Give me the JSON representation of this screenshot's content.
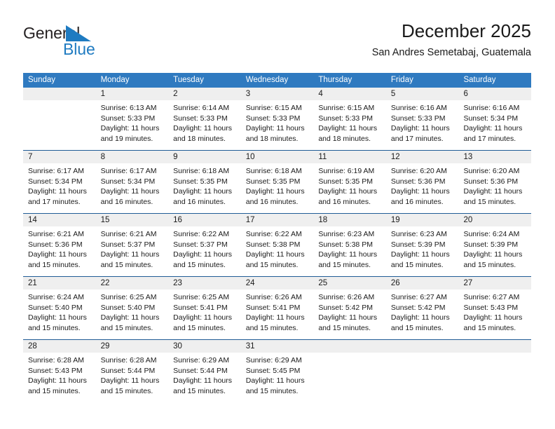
{
  "brand": {
    "word_one": "General",
    "word_two": "Blue",
    "triangle_icon": "triangle-icon",
    "color_blue": "#1f7bc1",
    "color_dark": "#231f20"
  },
  "header": {
    "title": "December 2025",
    "subtitle": "San Andres Semetabaj, Guatemala"
  },
  "theme": {
    "header_bg": "#2f7ac0",
    "header_text": "#ffffff",
    "week_separator": "#205c96",
    "date_band_bg": "#efefef",
    "body_bg": "#ffffff",
    "text": "#1a1a1a"
  },
  "calendar": {
    "weekdays": [
      "Sunday",
      "Monday",
      "Tuesday",
      "Wednesday",
      "Thursday",
      "Friday",
      "Saturday"
    ],
    "weeks": [
      [
        {
          "day": "",
          "lines": []
        },
        {
          "day": "1",
          "lines": [
            "Sunrise: 6:13 AM",
            "Sunset: 5:33 PM",
            "Daylight: 11 hours",
            "and 19 minutes."
          ]
        },
        {
          "day": "2",
          "lines": [
            "Sunrise: 6:14 AM",
            "Sunset: 5:33 PM",
            "Daylight: 11 hours",
            "and 18 minutes."
          ]
        },
        {
          "day": "3",
          "lines": [
            "Sunrise: 6:15 AM",
            "Sunset: 5:33 PM",
            "Daylight: 11 hours",
            "and 18 minutes."
          ]
        },
        {
          "day": "4",
          "lines": [
            "Sunrise: 6:15 AM",
            "Sunset: 5:33 PM",
            "Daylight: 11 hours",
            "and 18 minutes."
          ]
        },
        {
          "day": "5",
          "lines": [
            "Sunrise: 6:16 AM",
            "Sunset: 5:33 PM",
            "Daylight: 11 hours",
            "and 17 minutes."
          ]
        },
        {
          "day": "6",
          "lines": [
            "Sunrise: 6:16 AM",
            "Sunset: 5:34 PM",
            "Daylight: 11 hours",
            "and 17 minutes."
          ]
        }
      ],
      [
        {
          "day": "7",
          "lines": [
            "Sunrise: 6:17 AM",
            "Sunset: 5:34 PM",
            "Daylight: 11 hours",
            "and 17 minutes."
          ]
        },
        {
          "day": "8",
          "lines": [
            "Sunrise: 6:17 AM",
            "Sunset: 5:34 PM",
            "Daylight: 11 hours",
            "and 16 minutes."
          ]
        },
        {
          "day": "9",
          "lines": [
            "Sunrise: 6:18 AM",
            "Sunset: 5:35 PM",
            "Daylight: 11 hours",
            "and 16 minutes."
          ]
        },
        {
          "day": "10",
          "lines": [
            "Sunrise: 6:18 AM",
            "Sunset: 5:35 PM",
            "Daylight: 11 hours",
            "and 16 minutes."
          ]
        },
        {
          "day": "11",
          "lines": [
            "Sunrise: 6:19 AM",
            "Sunset: 5:35 PM",
            "Daylight: 11 hours",
            "and 16 minutes."
          ]
        },
        {
          "day": "12",
          "lines": [
            "Sunrise: 6:20 AM",
            "Sunset: 5:36 PM",
            "Daylight: 11 hours",
            "and 16 minutes."
          ]
        },
        {
          "day": "13",
          "lines": [
            "Sunrise: 6:20 AM",
            "Sunset: 5:36 PM",
            "Daylight: 11 hours",
            "and 15 minutes."
          ]
        }
      ],
      [
        {
          "day": "14",
          "lines": [
            "Sunrise: 6:21 AM",
            "Sunset: 5:36 PM",
            "Daylight: 11 hours",
            "and 15 minutes."
          ]
        },
        {
          "day": "15",
          "lines": [
            "Sunrise: 6:21 AM",
            "Sunset: 5:37 PM",
            "Daylight: 11 hours",
            "and 15 minutes."
          ]
        },
        {
          "day": "16",
          "lines": [
            "Sunrise: 6:22 AM",
            "Sunset: 5:37 PM",
            "Daylight: 11 hours",
            "and 15 minutes."
          ]
        },
        {
          "day": "17",
          "lines": [
            "Sunrise: 6:22 AM",
            "Sunset: 5:38 PM",
            "Daylight: 11 hours",
            "and 15 minutes."
          ]
        },
        {
          "day": "18",
          "lines": [
            "Sunrise: 6:23 AM",
            "Sunset: 5:38 PM",
            "Daylight: 11 hours",
            "and 15 minutes."
          ]
        },
        {
          "day": "19",
          "lines": [
            "Sunrise: 6:23 AM",
            "Sunset: 5:39 PM",
            "Daylight: 11 hours",
            "and 15 minutes."
          ]
        },
        {
          "day": "20",
          "lines": [
            "Sunrise: 6:24 AM",
            "Sunset: 5:39 PM",
            "Daylight: 11 hours",
            "and 15 minutes."
          ]
        }
      ],
      [
        {
          "day": "21",
          "lines": [
            "Sunrise: 6:24 AM",
            "Sunset: 5:40 PM",
            "Daylight: 11 hours",
            "and 15 minutes."
          ]
        },
        {
          "day": "22",
          "lines": [
            "Sunrise: 6:25 AM",
            "Sunset: 5:40 PM",
            "Daylight: 11 hours",
            "and 15 minutes."
          ]
        },
        {
          "day": "23",
          "lines": [
            "Sunrise: 6:25 AM",
            "Sunset: 5:41 PM",
            "Daylight: 11 hours",
            "and 15 minutes."
          ]
        },
        {
          "day": "24",
          "lines": [
            "Sunrise: 6:26 AM",
            "Sunset: 5:41 PM",
            "Daylight: 11 hours",
            "and 15 minutes."
          ]
        },
        {
          "day": "25",
          "lines": [
            "Sunrise: 6:26 AM",
            "Sunset: 5:42 PM",
            "Daylight: 11 hours",
            "and 15 minutes."
          ]
        },
        {
          "day": "26",
          "lines": [
            "Sunrise: 6:27 AM",
            "Sunset: 5:42 PM",
            "Daylight: 11 hours",
            "and 15 minutes."
          ]
        },
        {
          "day": "27",
          "lines": [
            "Sunrise: 6:27 AM",
            "Sunset: 5:43 PM",
            "Daylight: 11 hours",
            "and 15 minutes."
          ]
        }
      ],
      [
        {
          "day": "28",
          "lines": [
            "Sunrise: 6:28 AM",
            "Sunset: 5:43 PM",
            "Daylight: 11 hours",
            "and 15 minutes."
          ]
        },
        {
          "day": "29",
          "lines": [
            "Sunrise: 6:28 AM",
            "Sunset: 5:44 PM",
            "Daylight: 11 hours",
            "and 15 minutes."
          ]
        },
        {
          "day": "30",
          "lines": [
            "Sunrise: 6:29 AM",
            "Sunset: 5:44 PM",
            "Daylight: 11 hours",
            "and 15 minutes."
          ]
        },
        {
          "day": "31",
          "lines": [
            "Sunrise: 6:29 AM",
            "Sunset: 5:45 PM",
            "Daylight: 11 hours",
            "and 15 minutes."
          ]
        },
        {
          "day": "",
          "lines": []
        },
        {
          "day": "",
          "lines": []
        },
        {
          "day": "",
          "lines": []
        }
      ]
    ]
  }
}
